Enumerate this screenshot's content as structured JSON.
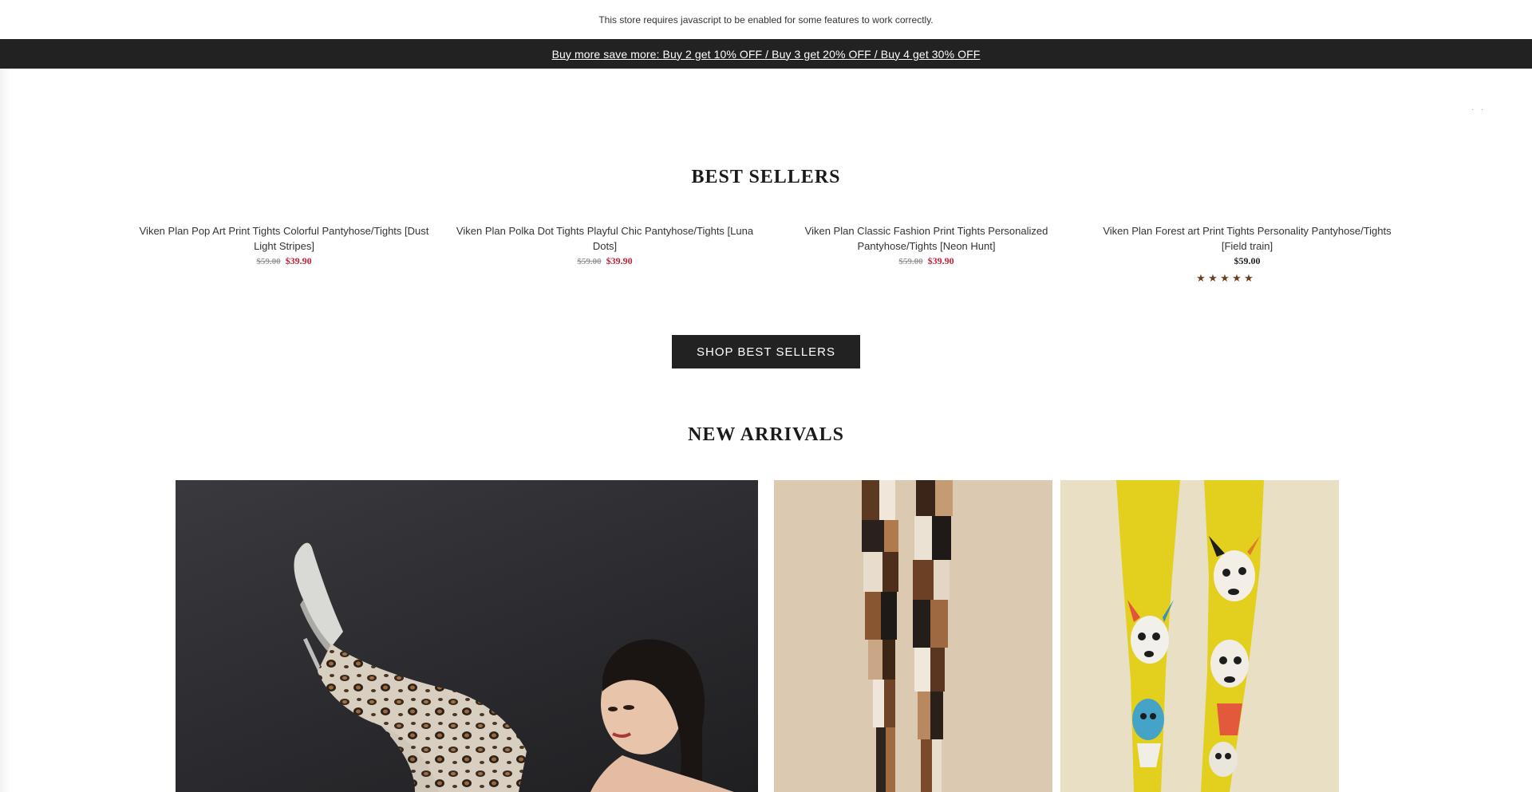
{
  "notice": {
    "text": "This store requires javascript to be enabled for some features to work correctly."
  },
  "promo": {
    "text": "Buy more save more: Buy 2 get 10% OFF / Buy 3 get 20% OFF / Buy 4 get 30% OFF"
  },
  "best_sellers": {
    "title": "BEST SELLERS",
    "products": [
      {
        "name": "Viken Plan Pop Art Print Tights Colorful Pantyhose/Tights [Dust Light Stripes]",
        "old_price": "$59.00",
        "price": "$39.90"
      },
      {
        "name": "Viken Plan Polka Dot Tights Playful Chic Pantyhose/Tights [Luna Dots]",
        "old_price": "$59.00",
        "price": "$39.90"
      },
      {
        "name": "Viken Plan Classic Fashion Print Tights Personalized Pantyhose/Tights [Neon Hunt]",
        "old_price": "$59.00",
        "price": "$39.90"
      },
      {
        "name": "Viken Plan Forest art Print Tights Personality Pantyhose/Tights [Field train]",
        "price": "$59.00",
        "rating": 5
      }
    ],
    "button_label": "SHOP BEST SELLERS"
  },
  "new_arrivals": {
    "title": "NEW ARRIVALS",
    "images": [
      {
        "icon": "leopard-tights-photo",
        "background": "#2b2b2f"
      },
      {
        "icon": "geometric-tights-photo",
        "background": "#dcc9b2"
      },
      {
        "icon": "dog-print-tights-photo",
        "background": "#e9dfc5"
      }
    ]
  },
  "colors": {
    "dark_bar": "#222222",
    "sale_red": "#c4213a",
    "star_brown": "#6b3f1a"
  }
}
